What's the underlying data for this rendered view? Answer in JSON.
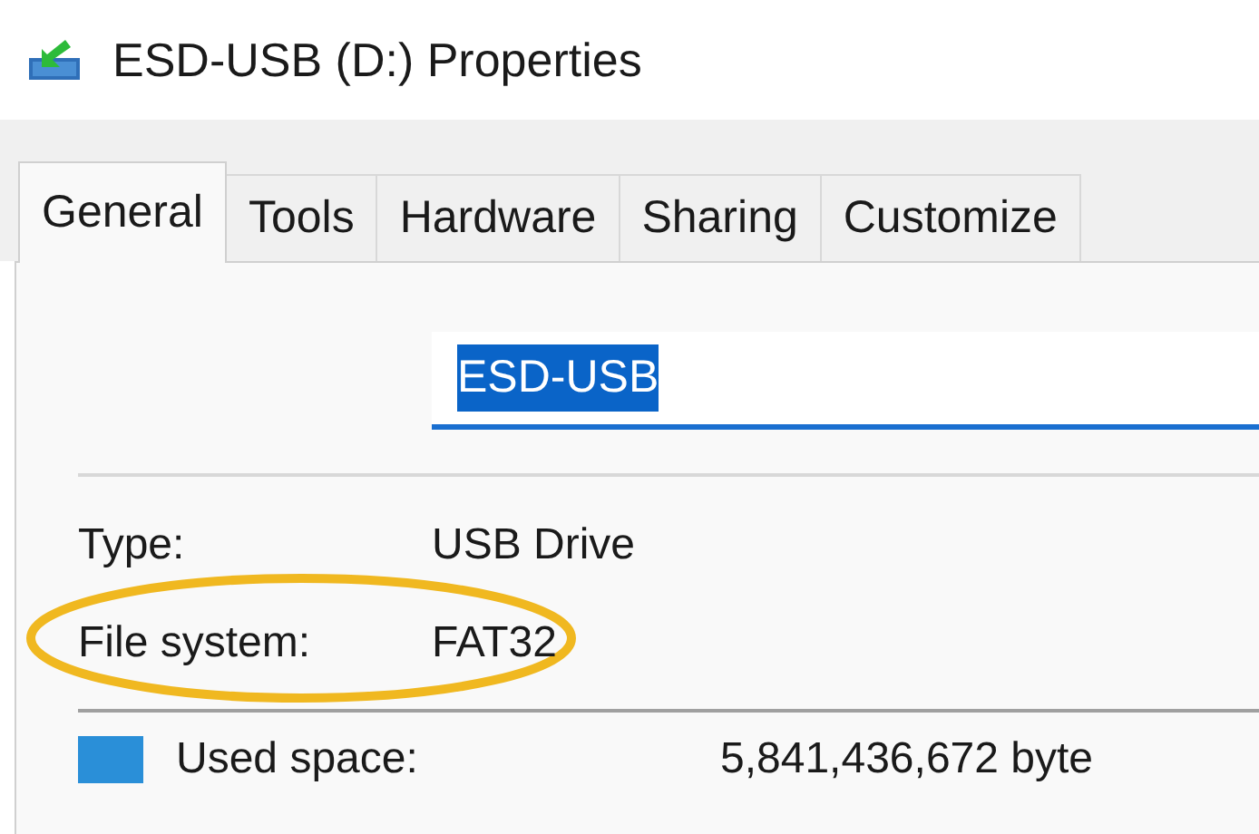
{
  "window": {
    "title": "ESD-USB (D:) Properties"
  },
  "tabs": [
    {
      "label": "General",
      "selected": true
    },
    {
      "label": "Tools",
      "selected": false
    },
    {
      "label": "Hardware",
      "selected": false
    },
    {
      "label": "Sharing",
      "selected": false
    },
    {
      "label": "Customize",
      "selected": false
    }
  ],
  "name_field": {
    "value": "ESD-USB",
    "text_selected": true
  },
  "properties": [
    {
      "label": "Type:",
      "value": "USB Drive",
      "highlighted": false
    },
    {
      "label": "File system:",
      "value": "FAT32",
      "highlighted": true
    }
  ],
  "space": [
    {
      "label": "Used space:",
      "value": "5,841,436,672 byte",
      "color": "#2a8fd8"
    }
  ]
}
